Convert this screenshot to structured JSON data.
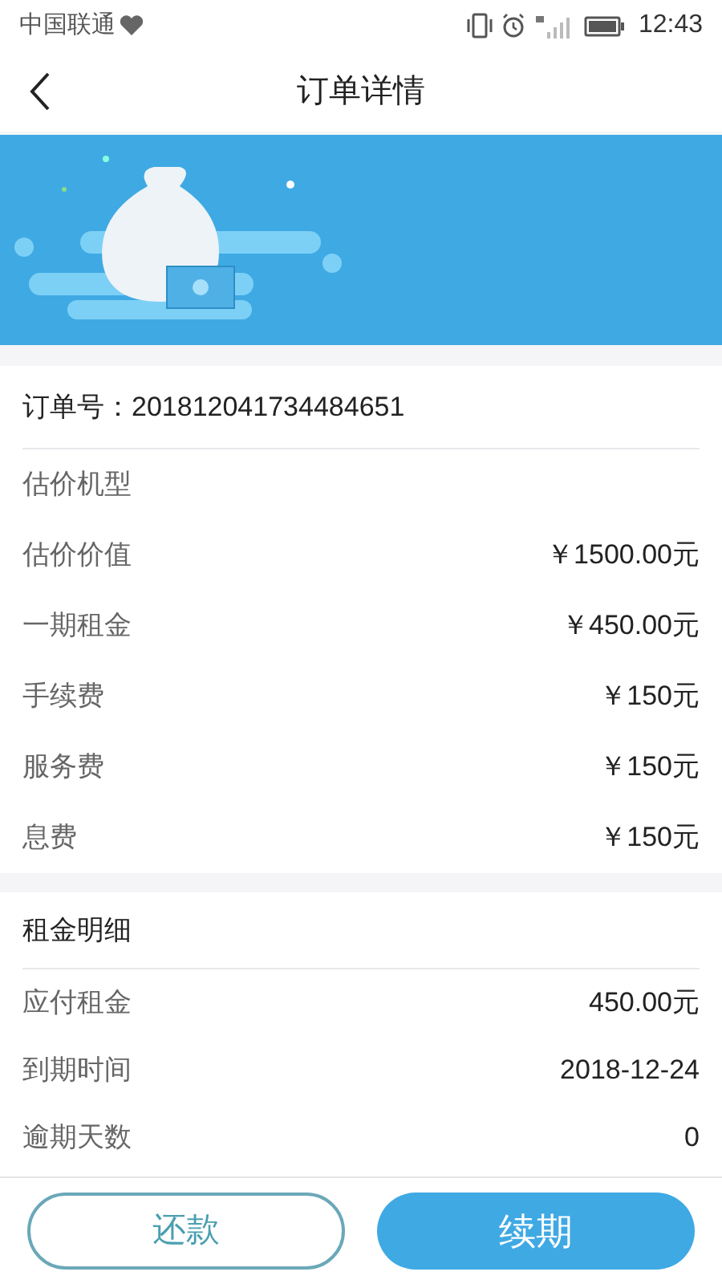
{
  "status_bar": {
    "carrier": "中国联通",
    "time": "12:43"
  },
  "header": {
    "title": "订单详情"
  },
  "order": {
    "label": "订单号：",
    "number": "201812041734484651"
  },
  "details": [
    {
      "label": "估价机型"
    },
    {
      "label": "估价价值",
      "value": "￥1500.00元"
    },
    {
      "label": "一期租金",
      "value": "￥450.00元"
    },
    {
      "label": "手续费",
      "value": "￥150元"
    },
    {
      "label": "服务费",
      "value": "￥150元"
    },
    {
      "label": "息费",
      "value": "￥150元"
    }
  ],
  "rent": {
    "title": "租金明细",
    "rows": [
      {
        "label": "应付租金",
        "value": "450.00元"
      },
      {
        "label": "到期时间",
        "value": "2018-12-24"
      },
      {
        "label": "逾期天数",
        "value": "0"
      }
    ]
  },
  "buttons": [
    {
      "label": "还款",
      "kind": "outline"
    },
    {
      "label": "续期",
      "kind": "filled"
    }
  ]
}
